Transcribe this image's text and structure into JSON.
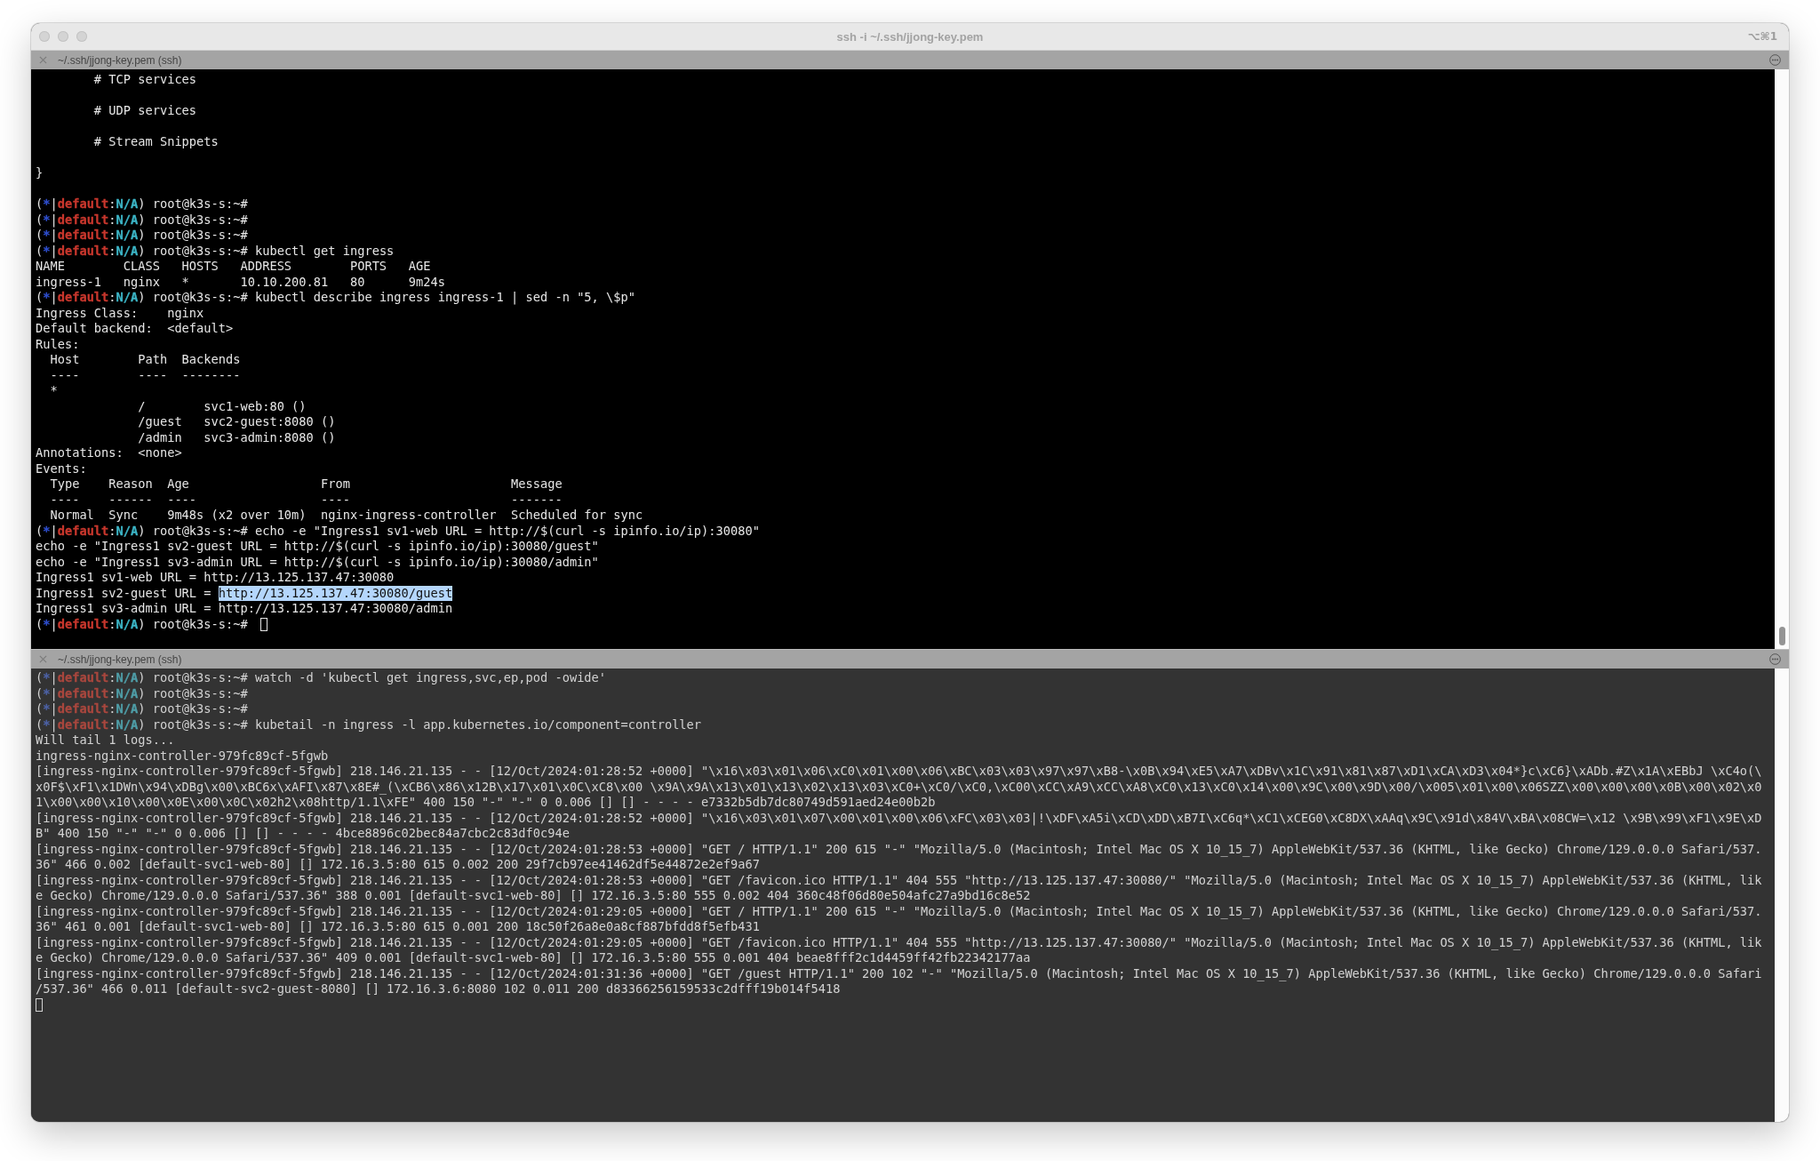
{
  "window": {
    "title": "ssh -i ~/.ssh/jjong-key.pem",
    "shortcut": "⌥⌘1"
  },
  "panes": [
    {
      "tab_title": "~/.ssh/jjong-key.pem (ssh)",
      "active": true,
      "scrollbar": true,
      "lines": [
        {
          "kind": "output",
          "text": "        # TCP services"
        },
        {
          "kind": "blank"
        },
        {
          "kind": "output",
          "text": "        # UDP services"
        },
        {
          "kind": "blank"
        },
        {
          "kind": "output",
          "text": "        # Stream Snippets"
        },
        {
          "kind": "blank"
        },
        {
          "kind": "output",
          "text": "}"
        },
        {
          "kind": "blank"
        },
        {
          "kind": "prompt",
          "prompt": [
            {
              "text": "("
            },
            {
              "text": "*",
              "color": "#2f4fd0"
            },
            {
              "text": "|"
            },
            {
              "text": "default",
              "color": "#c8372d"
            },
            {
              "text": ":"
            },
            {
              "text": "N/A",
              "color": "#3cb5c6"
            },
            {
              "text": ")"
            }
          ],
          "text": "root@k3s-s:~#"
        },
        {
          "kind": "prompt",
          "prompt": [
            {
              "text": "("
            },
            {
              "text": "*",
              "color": "#2f4fd0"
            },
            {
              "text": "|"
            },
            {
              "text": "default",
              "color": "#c8372d"
            },
            {
              "text": ":"
            },
            {
              "text": "N/A",
              "color": "#3cb5c6"
            },
            {
              "text": ")"
            }
          ],
          "text": "root@k3s-s:~#"
        },
        {
          "kind": "prompt",
          "prompt": [
            {
              "text": "("
            },
            {
              "text": "*",
              "color": "#2f4fd0"
            },
            {
              "text": "|"
            },
            {
              "text": "default",
              "color": "#c8372d"
            },
            {
              "text": ":"
            },
            {
              "text": "N/A",
              "color": "#3cb5c6"
            },
            {
              "text": ")"
            }
          ],
          "text": "root@k3s-s:~#"
        },
        {
          "kind": "prompt",
          "prompt": [
            {
              "text": "("
            },
            {
              "text": "*",
              "color": "#2f4fd0"
            },
            {
              "text": "|"
            },
            {
              "text": "default",
              "color": "#c8372d"
            },
            {
              "text": ":"
            },
            {
              "text": "N/A",
              "color": "#3cb5c6"
            },
            {
              "text": ")"
            }
          ],
          "text": "root@k3s-s:~# kubectl get ingress"
        },
        {
          "kind": "output",
          "text": "NAME        CLASS   HOSTS   ADDRESS        PORTS   AGE"
        },
        {
          "kind": "output",
          "text": "ingress-1   nginx   *       10.10.200.81   80      9m24s"
        },
        {
          "kind": "prompt",
          "prompt": [
            {
              "text": "("
            },
            {
              "text": "*",
              "color": "#2f4fd0"
            },
            {
              "text": "|"
            },
            {
              "text": "default",
              "color": "#c8372d"
            },
            {
              "text": ":"
            },
            {
              "text": "N/A",
              "color": "#3cb5c6"
            },
            {
              "text": ")"
            }
          ],
          "text": "root@k3s-s:~# kubectl describe ingress ingress-1 | sed -n \"5, \\$p\""
        },
        {
          "kind": "output",
          "text": "Ingress Class:    nginx"
        },
        {
          "kind": "output",
          "text": "Default backend:  <default>"
        },
        {
          "kind": "output",
          "text": "Rules:"
        },
        {
          "kind": "output",
          "text": "  Host        Path  Backends"
        },
        {
          "kind": "output",
          "text": "  ----        ----  --------"
        },
        {
          "kind": "output",
          "text": "  *"
        },
        {
          "kind": "output",
          "text": "              /        svc1-web:80 ()"
        },
        {
          "kind": "output",
          "text": "              /guest   svc2-guest:8080 ()"
        },
        {
          "kind": "output",
          "text": "              /admin   svc3-admin:8080 ()"
        },
        {
          "kind": "output",
          "text": "Annotations:  <none>"
        },
        {
          "kind": "output",
          "text": "Events:"
        },
        {
          "kind": "output",
          "text": "  Type    Reason  Age                  From                      Message"
        },
        {
          "kind": "output",
          "text": "  ----    ------  ----                 ----                      -------"
        },
        {
          "kind": "output",
          "text": "  Normal  Sync    9m48s (x2 over 10m)  nginx-ingress-controller  Scheduled for sync"
        },
        {
          "kind": "prompt",
          "prompt": [
            {
              "text": "("
            },
            {
              "text": "*",
              "color": "#2f4fd0"
            },
            {
              "text": "|"
            },
            {
              "text": "default",
              "color": "#c8372d"
            },
            {
              "text": ":"
            },
            {
              "text": "N/A",
              "color": "#3cb5c6"
            },
            {
              "text": ")"
            }
          ],
          "text": "root@k3s-s:~# echo -e \"Ingress1 sv1-web URL = http://$(curl -s ipinfo.io/ip):30080\""
        },
        {
          "kind": "output",
          "text": "echo -e \"Ingress1 sv2-guest URL = http://$(curl -s ipinfo.io/ip):30080/guest\""
        },
        {
          "kind": "output",
          "text": "echo -e \"Ingress1 sv3-admin URL = http://$(curl -s ipinfo.io/ip):30080/admin\""
        },
        {
          "kind": "output",
          "text": "Ingress1 sv1-web URL = http://13.125.137.47:30080"
        },
        {
          "kind": "output",
          "text": "Ingress1 sv2-guest URL = ",
          "selection": "http://13.125.137.47:30080/guest"
        },
        {
          "kind": "output",
          "text": "Ingress1 sv3-admin URL = http://13.125.137.47:30080/admin"
        },
        {
          "kind": "prompt",
          "prompt": [
            {
              "text": "("
            },
            {
              "text": "*",
              "color": "#2f4fd0"
            },
            {
              "text": "|"
            },
            {
              "text": "default",
              "color": "#c8372d"
            },
            {
              "text": ":"
            },
            {
              "text": "N/A",
              "color": "#3cb5c6"
            },
            {
              "text": ")"
            }
          ],
          "text": "root@k3s-s:~#",
          "cursor": true
        }
      ]
    },
    {
      "tab_title": "~/.ssh/jjong-key.pem (ssh)",
      "active": false,
      "scrollbar": false,
      "lines": [
        {
          "kind": "prompt",
          "prompt": [
            {
              "text": "("
            },
            {
              "text": "*",
              "color": "#4d62a6"
            },
            {
              "text": "|"
            },
            {
              "text": "default",
              "color": "#a9473e"
            },
            {
              "text": ":"
            },
            {
              "text": "N/A",
              "color": "#4f9ea8"
            },
            {
              "text": ")"
            }
          ],
          "text": "root@k3s-s:~# watch -d 'kubectl get ingress,svc,ep,pod -owide'"
        },
        {
          "kind": "prompt",
          "prompt": [
            {
              "text": "("
            },
            {
              "text": "*",
              "color": "#4d62a6"
            },
            {
              "text": "|"
            },
            {
              "text": "default",
              "color": "#a9473e"
            },
            {
              "text": ":"
            },
            {
              "text": "N/A",
              "color": "#4f9ea8"
            },
            {
              "text": ")"
            }
          ],
          "text": "root@k3s-s:~#"
        },
        {
          "kind": "prompt",
          "prompt": [
            {
              "text": "("
            },
            {
              "text": "*",
              "color": "#4d62a6"
            },
            {
              "text": "|"
            },
            {
              "text": "default",
              "color": "#a9473e"
            },
            {
              "text": ":"
            },
            {
              "text": "N/A",
              "color": "#4f9ea8"
            },
            {
              "text": ")"
            }
          ],
          "text": "root@k3s-s:~#"
        },
        {
          "kind": "prompt",
          "prompt": [
            {
              "text": "("
            },
            {
              "text": "*",
              "color": "#4d62a6"
            },
            {
              "text": "|"
            },
            {
              "text": "default",
              "color": "#a9473e"
            },
            {
              "text": ":"
            },
            {
              "text": "N/A",
              "color": "#4f9ea8"
            },
            {
              "text": ")"
            }
          ],
          "text": "root@k3s-s:~# kubetail -n ingress -l app.kubernetes.io/component=controller"
        },
        {
          "kind": "output",
          "text": "Will tail 1 logs..."
        },
        {
          "kind": "output",
          "text": "ingress-nginx-controller-979fc89cf-5fgwb"
        },
        {
          "kind": "output",
          "text": "[ingress-nginx-controller-979fc89cf-5fgwb] 218.146.21.135 - - [12/Oct/2024:01:28:52 +0000] \"\\x16\\x03\\x01\\x06\\xC0\\x01\\x00\\x06\\xBC\\x03\\x03\\x97\\x97\\xB8-\\x0B\\x94\\xE5\\xA7\\xDBv\\x1C\\x91\\x81\\x87\\xD1\\xCA\\xD3\\x04*}c\\xC6}\\xADb.#Z\\x1A\\xEBbJ \\xC4o(\\"
        },
        {
          "kind": "output",
          "text": "x0F$\\xF1\\x1DWn\\x94\\xDBg\\x00\\xBC6x\\xAFI\\x87\\x8E#_(\\xCB6\\x86\\x12B\\x17\\x01\\x0C\\xC8\\x00 \\x9A\\x9A\\x13\\x01\\x13\\x02\\x13\\x03\\xC0+\\xC0/\\xC0,\\xC00\\xCC\\xA9\\xCC\\xA8\\xC0\\x13\\xC0\\x14\\x00\\x9C\\x00\\x9D\\x00/\\x005\\x01\\x00\\x06SZZ\\x00\\x00\\x00\\x0B\\x00\\x02\\x0"
        },
        {
          "kind": "output",
          "text": "1\\x00\\x00\\x10\\x00\\x0E\\x00\\x0C\\x02h2\\x08http/1.1\\xFE\" 400 150 \"-\" \"-\" 0 0.006 [] [] - - - - e7332b5db7dc80749d591aed24e00b2b"
        },
        {
          "kind": "output",
          "text": "[ingress-nginx-controller-979fc89cf-5fgwb] 218.146.21.135 - - [12/Oct/2024:01:28:52 +0000] \"\\x16\\x03\\x01\\x07\\x00\\x01\\x00\\x06\\xFC\\x03\\x03|!\\xDF\\xA5i\\xCD\\xDD\\xB7I\\xC6q*\\xC1\\xCEG0\\xC8DX\\xAAq\\x9C\\x91d\\x84V\\xBA\\x08CW=\\x12 \\x9B\\x99\\xF1\\x9E\\xD"
        },
        {
          "kind": "output",
          "text": "B\" 400 150 \"-\" \"-\" 0 0.006 [] [] - - - - 4bce8896c02bec84a7cbc2c83df0c94e"
        },
        {
          "kind": "output",
          "text": "[ingress-nginx-controller-979fc89cf-5fgwb] 218.146.21.135 - - [12/Oct/2024:01:28:53 +0000] \"GET / HTTP/1.1\" 200 615 \"-\" \"Mozilla/5.0 (Macintosh; Intel Mac OS X 10_15_7) AppleWebKit/537.36 (KHTML, like Gecko) Chrome/129.0.0.0 Safari/537."
        },
        {
          "kind": "output",
          "text": "36\" 466 0.002 [default-svc1-web-80] [] 172.16.3.5:80 615 0.002 200 29f7cb97ee41462df5e44872e2ef9a67"
        },
        {
          "kind": "output",
          "text": "[ingress-nginx-controller-979fc89cf-5fgwb] 218.146.21.135 - - [12/Oct/2024:01:28:53 +0000] \"GET /favicon.ico HTTP/1.1\" 404 555 \"http://13.125.137.47:30080/\" \"Mozilla/5.0 (Macintosh; Intel Mac OS X 10_15_7) AppleWebKit/537.36 (KHTML, lik"
        },
        {
          "kind": "output",
          "text": "e Gecko) Chrome/129.0.0.0 Safari/537.36\" 388 0.001 [default-svc1-web-80] [] 172.16.3.5:80 555 0.002 404 360c48f06d80e504afc27a9bd16c8e52"
        },
        {
          "kind": "output",
          "text": "[ingress-nginx-controller-979fc89cf-5fgwb] 218.146.21.135 - - [12/Oct/2024:01:29:05 +0000] \"GET / HTTP/1.1\" 200 615 \"-\" \"Mozilla/5.0 (Macintosh; Intel Mac OS X 10_15_7) AppleWebKit/537.36 (KHTML, like Gecko) Chrome/129.0.0.0 Safari/537."
        },
        {
          "kind": "output",
          "text": "36\" 461 0.001 [default-svc1-web-80] [] 172.16.3.5:80 615 0.001 200 18c50f26a8e0a8cf887bfdd8f5efb431"
        },
        {
          "kind": "output",
          "text": "[ingress-nginx-controller-979fc89cf-5fgwb] 218.146.21.135 - - [12/Oct/2024:01:29:05 +0000] \"GET /favicon.ico HTTP/1.1\" 404 555 \"http://13.125.137.47:30080/\" \"Mozilla/5.0 (Macintosh; Intel Mac OS X 10_15_7) AppleWebKit/537.36 (KHTML, lik"
        },
        {
          "kind": "output",
          "text": "e Gecko) Chrome/129.0.0.0 Safari/537.36\" 409 0.001 [default-svc1-web-80] [] 172.16.3.5:80 555 0.001 404 beae8fff2c1d4459ff42fb22342177aa"
        },
        {
          "kind": "output",
          "text": "[ingress-nginx-controller-979fc89cf-5fgwb] 218.146.21.135 - - [12/Oct/2024:01:31:36 +0000] \"GET /guest HTTP/1.1\" 200 102 \"-\" \"Mozilla/5.0 (Macintosh; Intel Mac OS X 10_15_7) AppleWebKit/537.36 (KHTML, like Gecko) Chrome/129.0.0.0 Safari"
        },
        {
          "kind": "output",
          "text": "/537.36\" 466 0.011 [default-svc2-guest-8080] [] 172.16.3.6:8080 102 0.011 200 d83366256159533c2dfff19b014f5418"
        },
        {
          "kind": "blank",
          "cursor": true
        }
      ]
    }
  ]
}
